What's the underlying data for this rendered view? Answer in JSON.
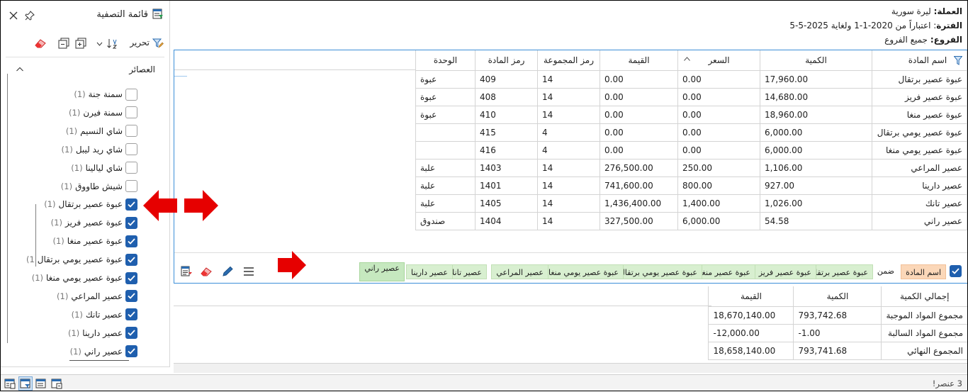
{
  "info": {
    "currency_label": "العملة:",
    "currency_value": "ليرة سورية",
    "period_label": "الفترة",
    "period_value": ": اعتباراً من 2020-1-1 ولغاية 2025-5-5",
    "branches_label": "الفروع:",
    "branches_value": "جميع الفروع"
  },
  "grid": {
    "columns": [
      "اسم المادة",
      "الكمية",
      "السعر",
      "القيمة",
      "رمز المجموعة",
      "رمز المادة",
      "الوحدة"
    ],
    "rows": [
      [
        "عبوة عصير برتقال",
        "17,960.00",
        "0.00",
        "0.00",
        "14",
        "409",
        "عبوة"
      ],
      [
        "عبوة عصير فريز",
        "14,680.00",
        "0.00",
        "0.00",
        "14",
        "408",
        "عبوة"
      ],
      [
        "عبوة عصير منغا",
        "18,960.00",
        "0.00",
        "0.00",
        "14",
        "410",
        "عبوة"
      ],
      [
        "عبوة عصير يومي برتقال",
        "6,000.00",
        "0.00",
        "0.00",
        "4",
        "415",
        ""
      ],
      [
        "عبوة عصير يومي منغا",
        "6,000.00",
        "0.00",
        "0.00",
        "4",
        "416",
        ""
      ],
      [
        "عصير المراعي",
        "1,106.00",
        "250.00",
        "276,500.00",
        "14",
        "1403",
        "علبة"
      ],
      [
        "عصير دارينا",
        "927.00",
        "800.00",
        "741,600.00",
        "14",
        "1401",
        "علبة"
      ],
      [
        "عصير تانك",
        "1,026.00",
        "1,400.00",
        "1,436,400.00",
        "14",
        "1405",
        "علبة"
      ],
      [
        "عصير راني",
        "54.58",
        "6,000.00",
        "327,500.00",
        "14",
        "1404",
        "صندوق"
      ]
    ]
  },
  "group_bar": {
    "field_chip": "اسم المادة",
    "within_label": "ضمن",
    "chips": [
      "عبوة عصير برتقال",
      "عبوة عصير فريز",
      "عبوة عصير منغا",
      "عبوة عصير يومي برتقال",
      "عبوة عصير يومي منغا",
      "عصير المراعي",
      "عصير تانك",
      "عصير دارينا"
    ],
    "selected_chip": "عصير راني"
  },
  "summary": {
    "columns": [
      "إجمالي الكمية",
      "الكمية",
      "القيمة"
    ],
    "rows": [
      [
        "مجموع المواد الموجبة",
        "793,742.68",
        "18,670,140.00"
      ],
      [
        "مجموع المواد السالبة",
        "-1.00",
        "-12,000.00"
      ],
      [
        "المجموع النهائي",
        "793,741.68",
        "18,658,140.00"
      ]
    ]
  },
  "panel": {
    "title": "قائمة التصفية",
    "edit_label": "تحرير",
    "group_title": "العصائر",
    "items": [
      {
        "label": "سمنة جنة",
        "count": "(1)",
        "checked": false
      },
      {
        "label": "سمنة فيرن",
        "count": "(1)",
        "checked": false
      },
      {
        "label": "شاي النسيم",
        "count": "(1)",
        "checked": false
      },
      {
        "label": "شاي ريد ليبل",
        "count": "(1)",
        "checked": false
      },
      {
        "label": "شاي ليالينا",
        "count": "(1)",
        "checked": false
      },
      {
        "label": "شيش طاووق",
        "count": "(1)",
        "checked": false
      },
      {
        "label": "عبوة عصير برتقال",
        "count": "(1)",
        "checked": true
      },
      {
        "label": "عبوة عصير فريز",
        "count": "(1)",
        "checked": true
      },
      {
        "label": "عبوة عصير منغا",
        "count": "(1)",
        "checked": true
      },
      {
        "label": "عبوة عصير يومي برتقال",
        "count": "(1",
        "checked": true
      },
      {
        "label": "عبوة عصير يومي منغا",
        "count": "(1)",
        "checked": true
      },
      {
        "label": "عصير المراعي",
        "count": "(1)",
        "checked": true
      },
      {
        "label": "عصير تانك",
        "count": "(1)",
        "checked": true
      },
      {
        "label": "عصير دارينا",
        "count": "(1)",
        "checked": true
      },
      {
        "label": "عصير راني",
        "count": "(1)",
        "checked": true
      }
    ]
  },
  "status": {
    "count_text": "3 عنصر!"
  },
  "colors": {
    "accent": "#1f5fae",
    "arrow": "#e60000",
    "chip_green": "#d8efd0",
    "chip_orange": "#fbd7b8"
  }
}
